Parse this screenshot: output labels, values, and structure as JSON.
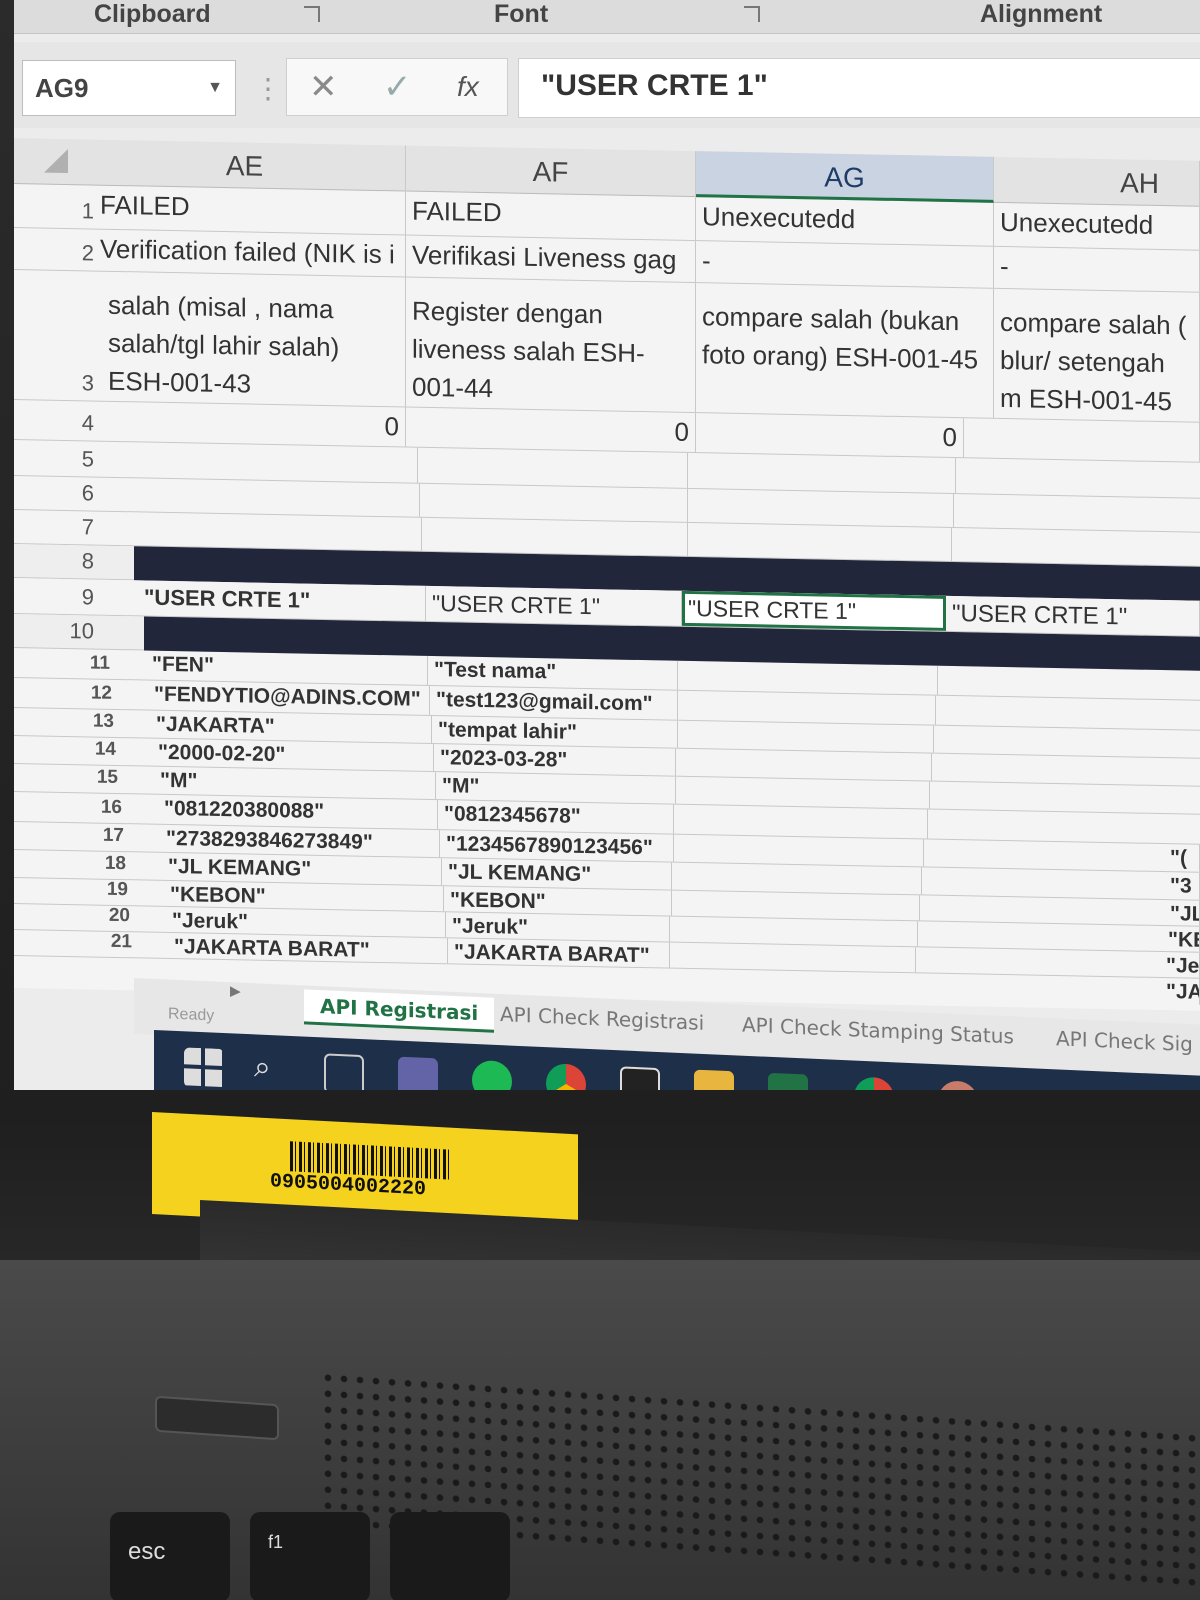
{
  "ribbon": {
    "groups": [
      "Clipboard",
      "Font",
      "Alignment"
    ]
  },
  "formula_bar": {
    "name_box": "AG9",
    "fx_label": "fx",
    "formula": "\"USER CRTE 1\""
  },
  "grid": {
    "columns": [
      "AE",
      "AF",
      "AG",
      "AH"
    ],
    "selected_column": "AG",
    "rows": {
      "r1": {
        "num": "1",
        "ae": "FAILED",
        "af": "FAILED",
        "ag": "Unexecutedd",
        "ah": "Unexecutedd"
      },
      "r2": {
        "num": "2",
        "ae": "Verification failed (NIK is i",
        "af": "Verifikasi Liveness gag",
        "ag": "-",
        "ah": "-"
      },
      "r3": {
        "num": "3",
        "ae": "salah (misal , nama salah/tgl lahir salah) ESH-001-43",
        "af": "Register dengan liveness salah ESH-001-44",
        "ag": "compare salah (bukan foto orang) ESH-001-45",
        "ah": "compare salah ( blur/ setengah m ESH-001-45"
      },
      "r4": {
        "num": "4",
        "ae": "0",
        "af": "0",
        "ag": "0"
      },
      "r5": {
        "num": "5"
      },
      "r6": {
        "num": "6"
      },
      "r7": {
        "num": "7"
      },
      "r8": {
        "num": "8"
      },
      "r9": {
        "num": "9",
        "ae": "\"USER CRTE 1\"",
        "af": "\"USER CRTE 1\"",
        "ag": "\"USER CRTE 1\"",
        "ah": "\"USER CRTE 1\""
      },
      "r10": {
        "num": "10"
      },
      "r11": {
        "num": "11",
        "ae": "\"FEN\"",
        "af": "\"Test nama\""
      },
      "r12": {
        "num": "12",
        "ae": "\"FENDYTIO@ADINS.COM\"",
        "af": "\"test123@gmail.com\""
      },
      "r13": {
        "num": "13",
        "ae": "\"JAKARTA\"",
        "af": "\"tempat lahir\""
      },
      "r14": {
        "num": "14",
        "ae": "\"2000-02-20\"",
        "af": "\"2023-03-28\""
      },
      "r15": {
        "num": "15",
        "ae": "\"M\"",
        "af": "\"M\""
      },
      "r16": {
        "num": "16",
        "ae": "\"081220380088\"",
        "af": "\"0812345678\""
      },
      "r17": {
        "num": "17",
        "ae": "\"2738293846273849\"",
        "af": "\"1234567890123456\"",
        "ah": "\"("
      },
      "r18": {
        "num": "18",
        "ae": "\"JL KEMANG\"",
        "af": "\"JL KEMANG\"",
        "ah": "\"3"
      },
      "r19": {
        "num": "19",
        "ae": "\"KEBON\"",
        "af": "\"KEBON\"",
        "ah": "\"JL"
      },
      "r20": {
        "num": "20",
        "ae": "\"Jeruk\"",
        "af": "\"Jeruk\"",
        "ah": "\"KE"
      },
      "r21": {
        "num": "21",
        "ae": "\"JAKARTA BARAT\"",
        "af": "\"JAKARTA BARAT\"",
        "ah": "\"Jer"
      }
    },
    "extra_ah": "\"JAK"
  },
  "status": {
    "ready": "Ready"
  },
  "sheet_tabs": [
    "API Registrasi",
    "API Check Registrasi",
    "API Check Stamping Status",
    "API Check Sig"
  ],
  "active_sheet": "API Registrasi",
  "taskbar_icons": [
    "windows-icon",
    "search-icon",
    "task-view-icon",
    "teams-icon",
    "spotify-icon",
    "chrome-icon",
    "notes-icon",
    "file-explorer-icon",
    "excel-icon",
    "chrome-icon",
    "paint-icon",
    "settings-icon"
  ],
  "sticker": {
    "barcode_number": "0905004002220"
  },
  "keyboard": {
    "esc": "esc",
    "f1": "f1"
  },
  "colors": {
    "excel_green": "#217346",
    "header_dark": "#22263a",
    "taskbar": "#1e2f4a",
    "sticker": "#f4d21e"
  }
}
